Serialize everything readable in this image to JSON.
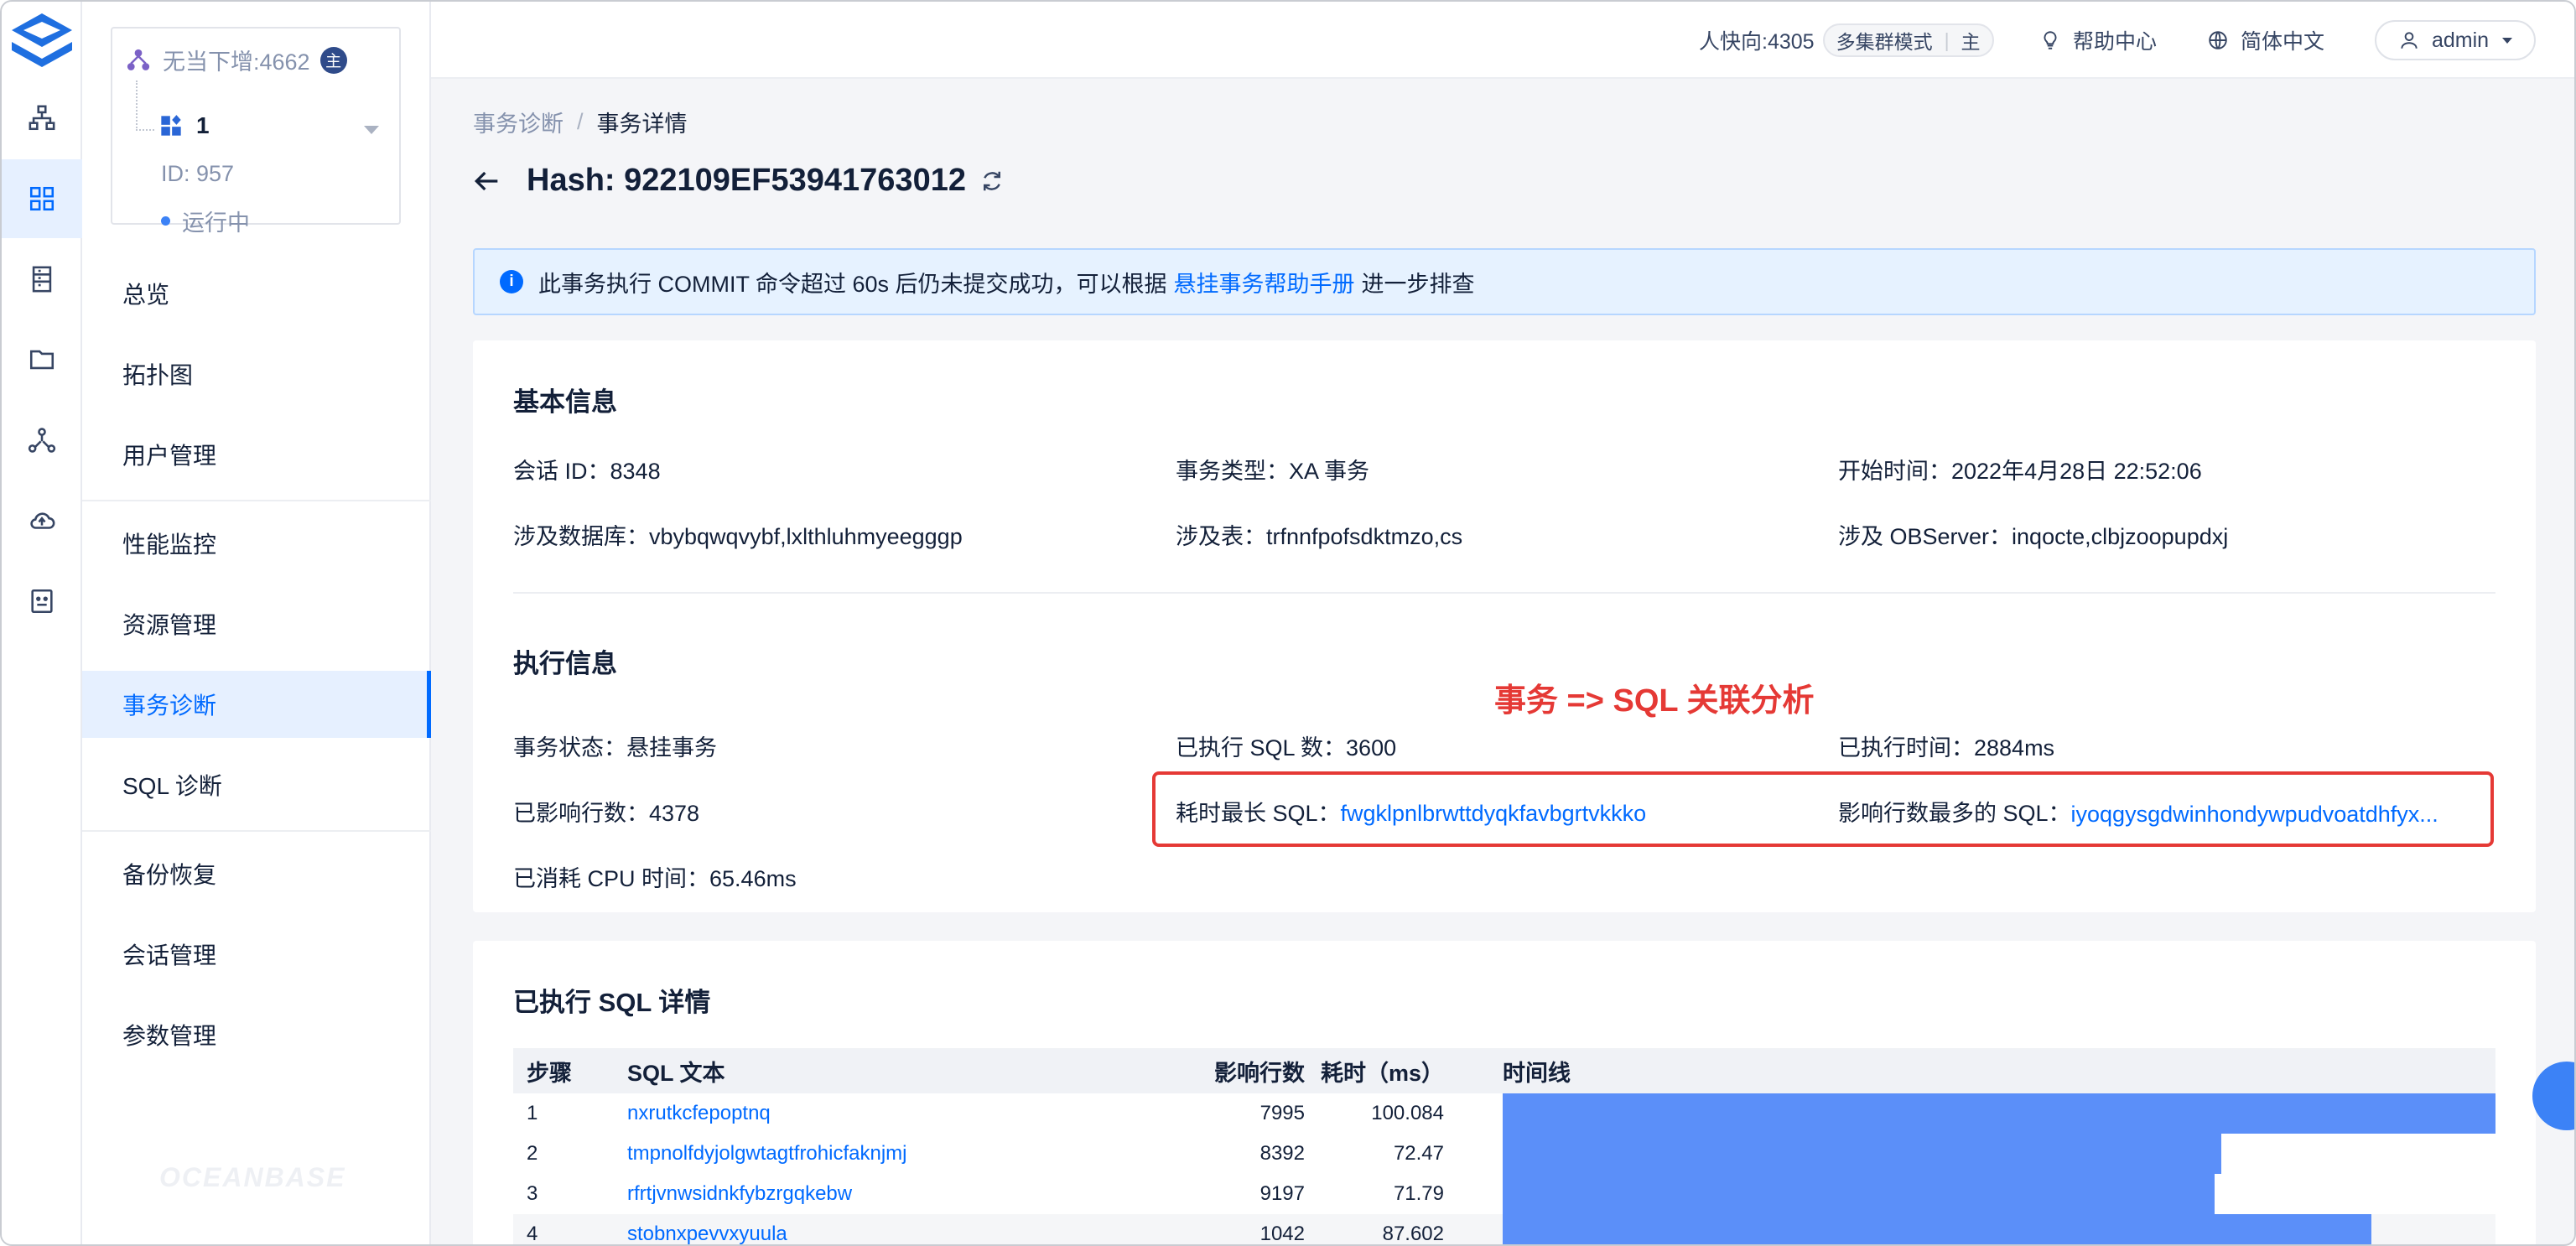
{
  "topbar": {
    "lag_label": "人快向:4305",
    "mode_label": "多集群模式",
    "role_label": "主",
    "help_label": "帮助中心",
    "language_label": "简体中文",
    "user_label": "admin"
  },
  "cluster_card": {
    "name": "无当下增:4662",
    "badge": "主",
    "tenant": "1",
    "id_text": "ID: 957",
    "status": "运行中"
  },
  "menu": {
    "items": [
      "总览",
      "拓扑图",
      "用户管理",
      "性能监控",
      "资源管理",
      "事务诊断",
      "SQL 诊断",
      "备份恢复",
      "会话管理",
      "参数管理"
    ],
    "active": "事务诊断"
  },
  "footer_logo": "OCEANBASE",
  "breadcrumb": {
    "parent": "事务诊断",
    "current": "事务详情"
  },
  "page_title": "Hash: 922109EF53941763012",
  "alert": {
    "prefix": "此事务执行 COMMIT 命令超过 60s 后仍未提交成功，可以根据",
    "link": "悬挂事务帮助手册",
    "suffix": "进一步排查"
  },
  "basic": {
    "title": "基本信息",
    "session_label": "会话 ID：",
    "session_value": "8348",
    "type_label": "事务类型：",
    "type_value": "XA 事务",
    "start_label": "开始时间：",
    "start_value": "2022年4月28日 22:52:06",
    "db_label": "涉及数据库：",
    "db_value": "vbybqwqvybf,lxlthluhmyeegggp",
    "table_label": "涉及表：",
    "table_value": "trfnnfpofsdktmzo,cs",
    "observer_label": "涉及 OBServer：",
    "observer_value": "inqocte,clbjzoopupdxj"
  },
  "exec": {
    "title": "执行信息",
    "annotation": "事务 => SQL 关联分析",
    "state_label": "事务状态：",
    "state_value": "悬挂事务",
    "sqlcount_label": "已执行 SQL 数：",
    "sqlcount_value": "3600",
    "elapsed_label": "已执行时间：",
    "elapsed_value": "2884ms",
    "affected_label": "已影响行数：",
    "affected_value": "4378",
    "longest_label": "耗时最长 SQL：",
    "longest_value": "fwgklpnlbrwttdyqkfavbgrtvkkko",
    "mostrows_label": "影响行数最多的 SQL：",
    "mostrows_value": "iyoqgysgdwinhondywpudvoatdhfyx...",
    "cpu_label": "已消耗 CPU 时间：",
    "cpu_value": "65.46ms"
  },
  "sql_table": {
    "title": "已执行 SQL 详情",
    "headers": {
      "step": "步骤",
      "sql": "SQL 文本",
      "rows": "影响行数",
      "time": "耗时（ms）",
      "timeline": "时间线"
    },
    "rows": [
      {
        "step": "1",
        "sql": "nxrutkcfepoptnq",
        "rows": "7995",
        "time": "100.084",
        "timeline_start": 0.0,
        "timeline_end": 1.0
      },
      {
        "step": "2",
        "sql": "tmpnolfdyjolgwtagtfrohicfaknjmj",
        "rows": "8392",
        "time": "72.47",
        "timeline_start": 0.0,
        "timeline_end": 0.724
      },
      {
        "step": "3",
        "sql": "rfrtjvnwsidnkfybzrgqkebw",
        "rows": "9197",
        "time": "71.79",
        "timeline_start": 0.0,
        "timeline_end": 0.717
      },
      {
        "step": "4",
        "sql": "stobnxpevvxyuula",
        "rows": "1042",
        "time": "87.602",
        "timeline_start": 0.0,
        "timeline_end": 0.875
      }
    ]
  },
  "colors": {
    "primary": "#006aff",
    "annotation": "#e53935",
    "bar": "#5b8ff9"
  }
}
